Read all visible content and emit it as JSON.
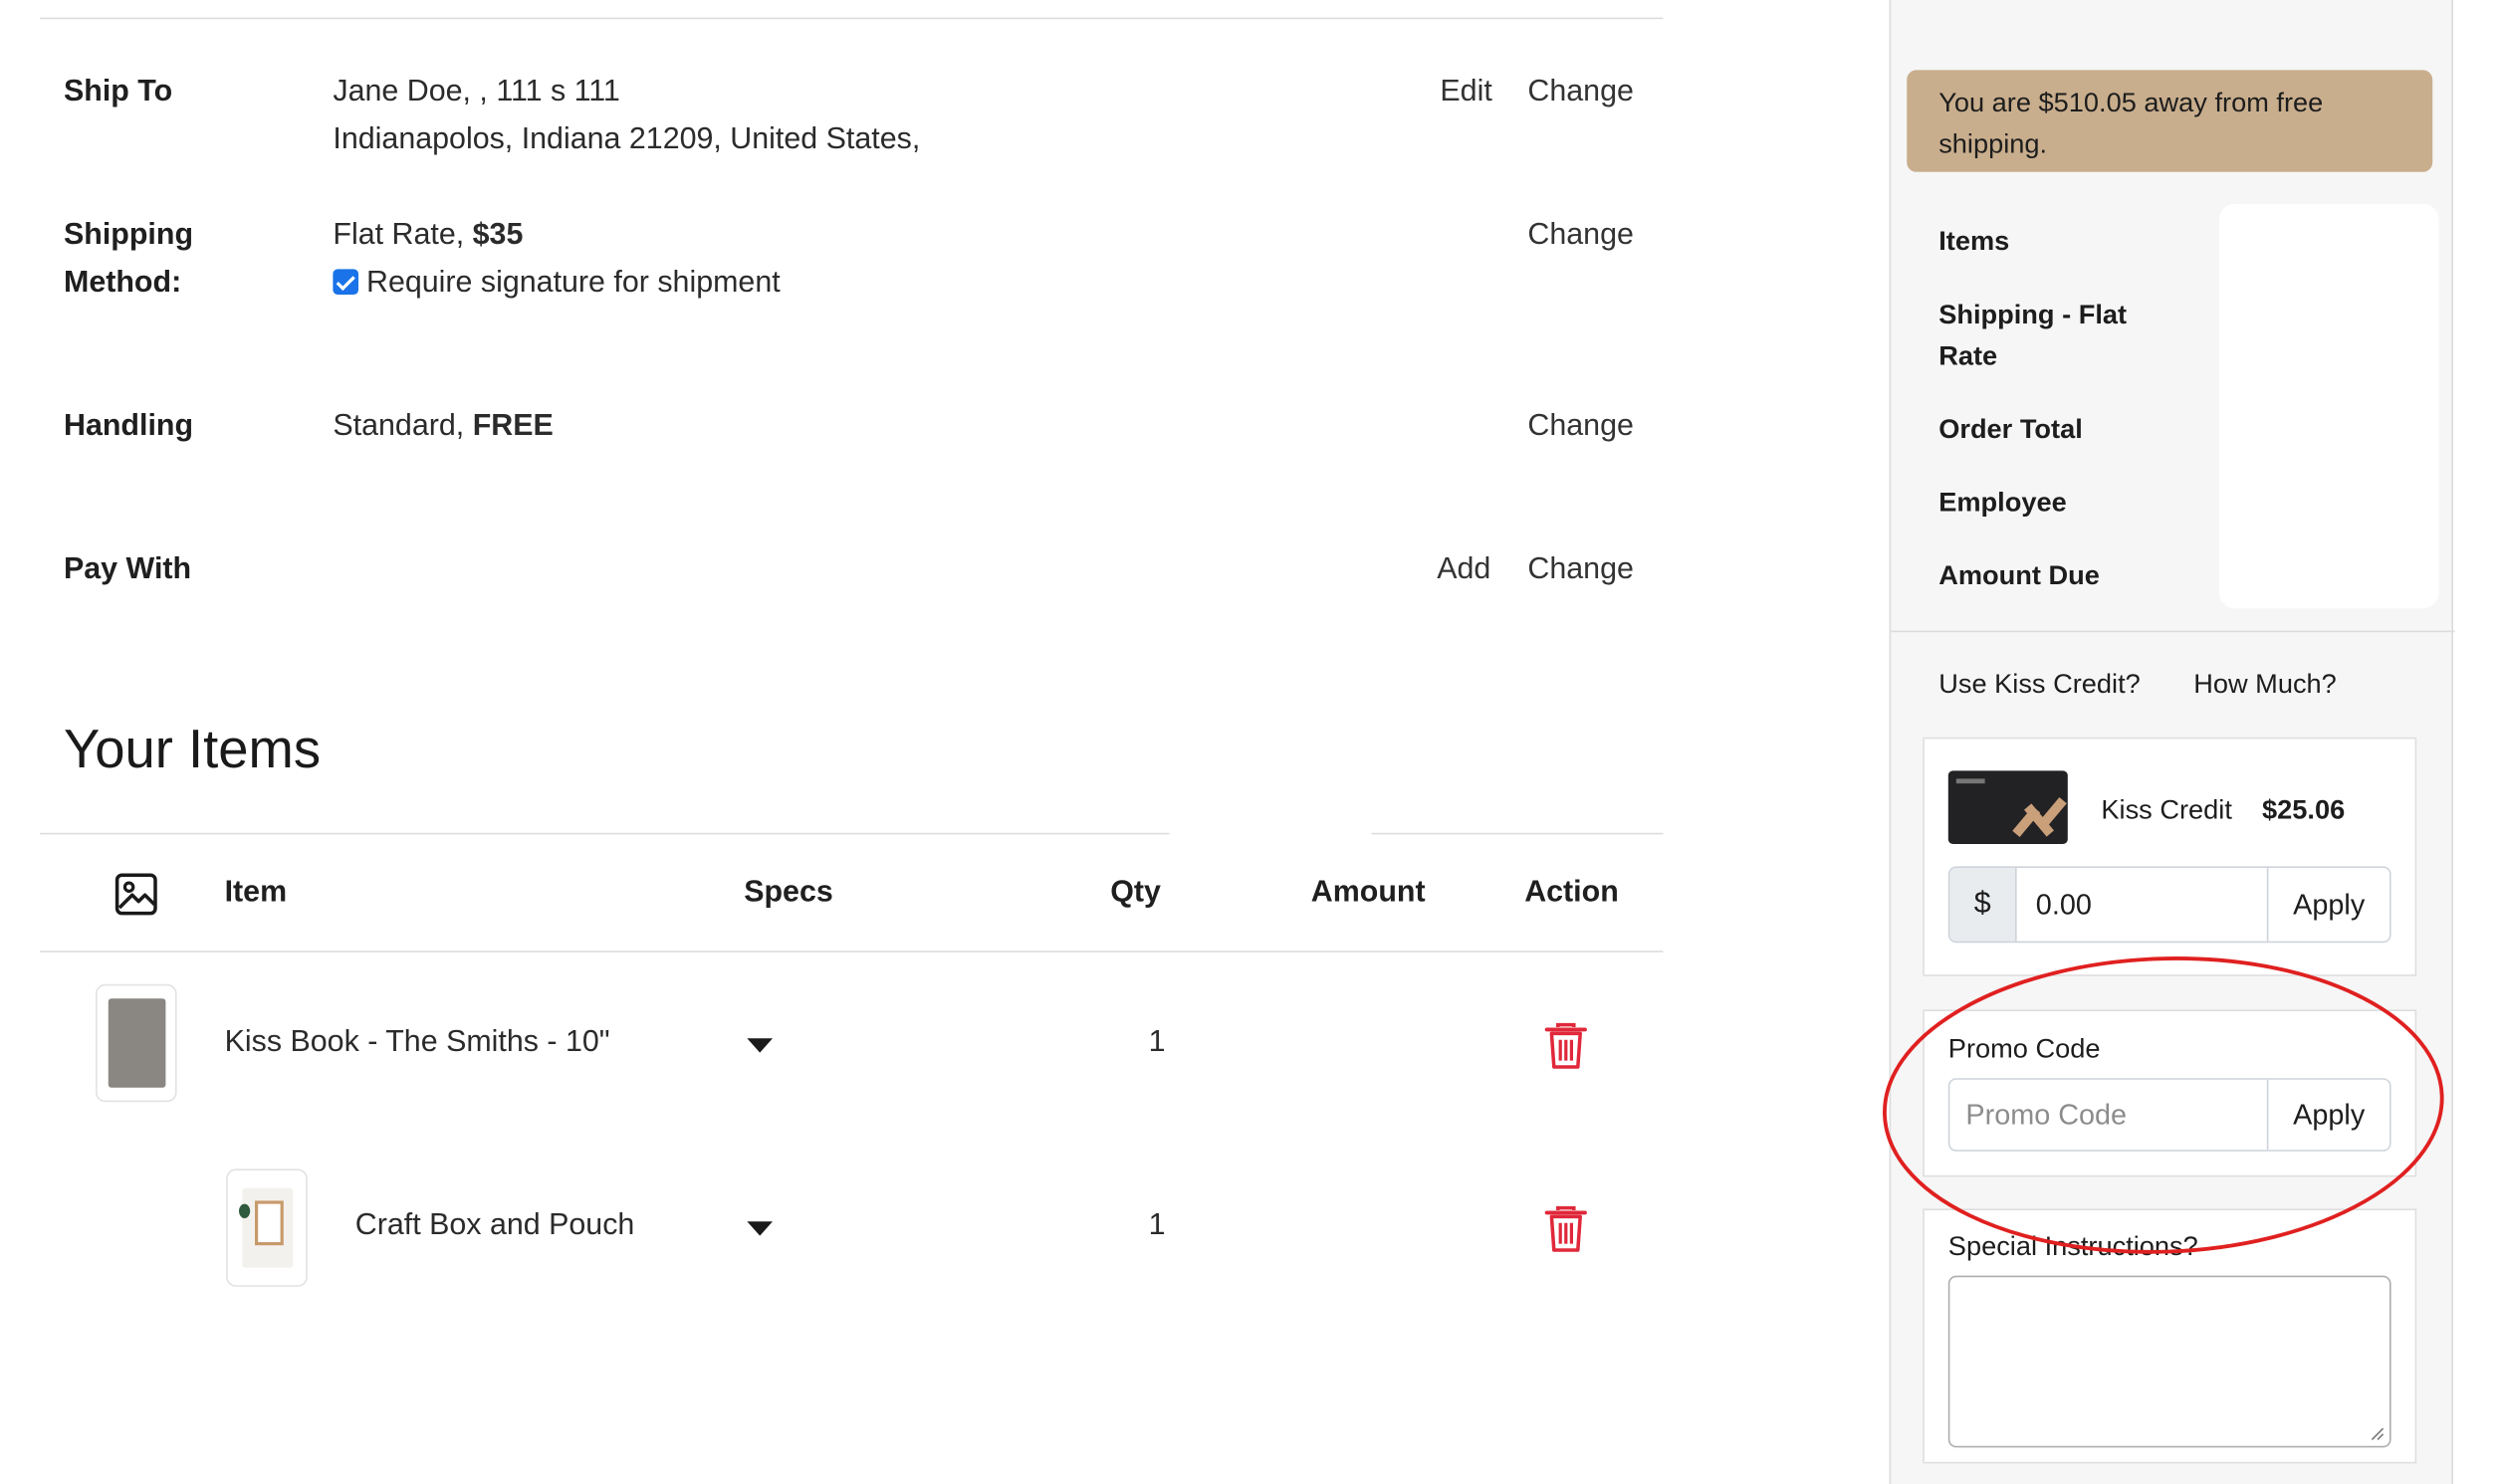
{
  "checkout": {
    "ship_to": {
      "label": "Ship To",
      "line1": "Jane Doe, , 111 s 111",
      "line2": "Indianapolos, Indiana 21209, United States,",
      "edit_label": "Edit",
      "change_label": "Change"
    },
    "shipping_method": {
      "label_line1": "Shipping",
      "label_line2": "Method:",
      "method_name": "Flat Rate,",
      "method_price": "$35",
      "signature_label": "Require signature for shipment",
      "signature_checked": true,
      "change_label": "Change"
    },
    "handling": {
      "label": "Handling",
      "value_name": "Standard,",
      "value_price": "FREE",
      "change_label": "Change"
    },
    "pay_with": {
      "label": "Pay With",
      "add_label": "Add",
      "change_label": "Change"
    }
  },
  "items": {
    "heading": "Your Items",
    "columns": {
      "item": "Item",
      "specs": "Specs",
      "qty": "Qty",
      "amount": "Amount",
      "action": "Action"
    },
    "rows": [
      {
        "name": "Kiss Book - The Smiths - 10\"",
        "qty": "1"
      },
      {
        "name": "Craft Box and Pouch",
        "qty": "1"
      }
    ]
  },
  "sidebar": {
    "free_shipping_banner": "You are $510.05 away from free shipping.",
    "summary_labels": {
      "items": "Items",
      "shipping_line1": "Shipping - Flat",
      "shipping_line2": "Rate",
      "order_total": "Order Total",
      "employee": "Employee",
      "amount_due": "Amount Due"
    },
    "kiss_credit": {
      "question": "Use Kiss Credit?",
      "how_much": "How Much?",
      "card_label": "Kiss Credit",
      "balance": "$25.06",
      "currency_symbol": "$",
      "amount_value": "0.00",
      "apply_label": "Apply"
    },
    "promo": {
      "label": "Promo Code",
      "placeholder": "Promo Code",
      "apply_label": "Apply"
    },
    "special_instructions": {
      "label": "Special Instructions?"
    }
  },
  "colors": {
    "banner": "#c9ae8d",
    "trash": "#e0283a",
    "checkbox": "#1a73e8",
    "annotation": "#e02020"
  }
}
